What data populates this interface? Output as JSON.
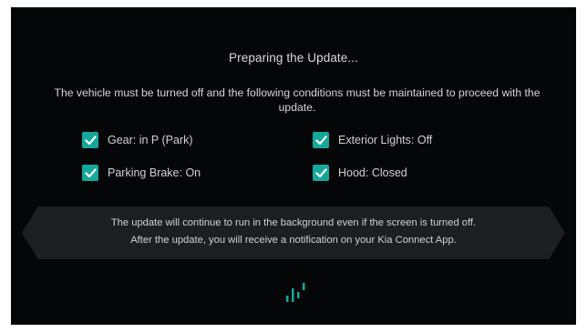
{
  "screen": {
    "title": "Preparing the Update...",
    "message": "The vehicle must be turned off and the following conditions must be maintained to proceed with the update."
  },
  "conditions": [
    {
      "label": "Gear: in P (Park)",
      "checked": true
    },
    {
      "label": "Exterior Lights: Off",
      "checked": true
    },
    {
      "label": "Parking Brake: On",
      "checked": true
    },
    {
      "label": "Hood: Closed",
      "checked": true
    }
  ],
  "notice": {
    "line1": "The update will continue to run in the background even if the screen is turned off.",
    "line2": "After the update, you will receive a notification on your Kia Connect App."
  },
  "icons": {
    "check": "checkmark-icon",
    "loader": "loading-bars-icon"
  },
  "colors": {
    "background": "#050607",
    "accent": "#14a89a",
    "text": "#d4d6d7",
    "panel": "#1c1f21"
  }
}
